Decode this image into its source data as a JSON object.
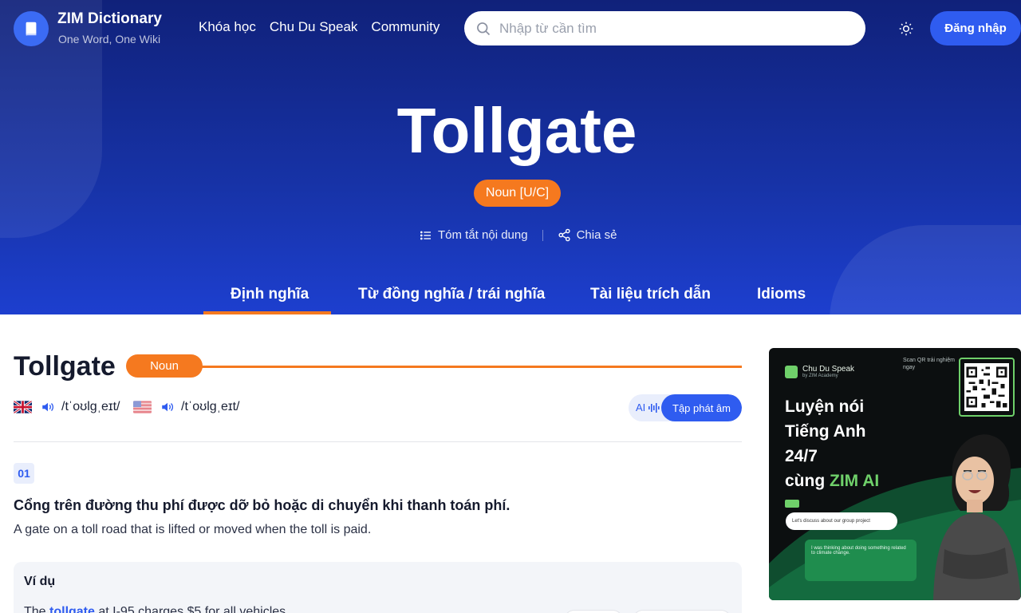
{
  "header": {
    "brand_name": "ZIM Dictionary",
    "brand_tagline": "One Word, One Wiki",
    "nav": [
      "Khóa học",
      "Chu Du Speak",
      "Community"
    ],
    "search_placeholder": "Nhập từ cần tìm",
    "login_label": "Đăng nhập"
  },
  "hero": {
    "word": "Tollgate",
    "pos_badge": "Noun [U/C]",
    "summary_label": "Tóm tắt nội dung",
    "share_label": "Chia sẻ",
    "tabs": [
      "Định nghĩa",
      "Từ đồng nghĩa / trái nghĩa",
      "Tài liệu trích dẫn",
      "Idioms"
    ]
  },
  "entry": {
    "word": "Tollgate",
    "pos": "Noun",
    "pron_uk": "/tˈoʊlɡˌeɪt/",
    "pron_us": "/tˈoʊlɡˌeɪt/",
    "practice_ai": "AI",
    "practice_label": "Tập phát âm",
    "senses": [
      {
        "num": "01",
        "def_vi": "Cổng trên đường thu phí được dỡ bỏ hoặc di chuyển khi thanh toán phí.",
        "def_en": "A gate on a toll road that is lifted or moved when the toll is paid."
      }
    ],
    "example_title": "Ví dụ",
    "example_before": "The ",
    "example_highlight": "tollgate",
    "example_after": " at I-95 charges $5 for all vehicles."
  },
  "ad": {
    "brand": "Chu Du Speak",
    "brand_sub": "by ZIM Academy",
    "scan_text": "Scan QR trải nghiệm ngay",
    "headline_line1": "Luyện nói",
    "headline_line2": "Tiếng Anh",
    "headline_line3": "24/7",
    "headline_line4_pre": "cùng ",
    "headline_line4_accent": "ZIM AI",
    "bubble_text": "Let's discuss about our group project",
    "card_text": "I was thinking about doing something related to climate change."
  },
  "colors": {
    "hero_top": "#10217a",
    "hero_bottom": "#1d3fcf",
    "accent_orange": "#f5791f",
    "primary_blue": "#2f5cf0",
    "ad_green": "#6fd06a"
  },
  "icons": {
    "logo": "book-icon",
    "search": "search-icon",
    "theme": "sun-icon",
    "summary": "list-icon",
    "share": "share-icon",
    "speaker": "speaker-icon",
    "flag_uk": "uk-flag-icon",
    "flag_us": "us-flag-icon",
    "voice": "voice-wave-icon"
  }
}
